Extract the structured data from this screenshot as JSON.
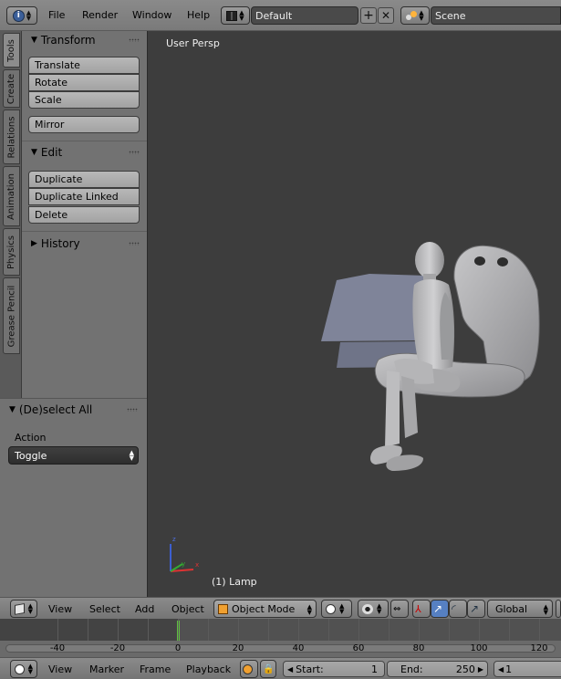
{
  "topbar": {
    "menus": [
      "File",
      "Render",
      "Window",
      "Help"
    ],
    "screen_layout": "Default",
    "scene": "Scene"
  },
  "tabs": [
    "Tools",
    "Create",
    "Relations",
    "Animation",
    "Physics",
    "Grease Pencil"
  ],
  "toolshelf": {
    "transform": {
      "title": "Transform",
      "buttons": [
        "Translate",
        "Rotate",
        "Scale"
      ],
      "mirror": "Mirror"
    },
    "edit": {
      "title": "Edit",
      "buttons": [
        "Duplicate",
        "Duplicate Linked",
        "Delete"
      ]
    },
    "history": {
      "title": "History"
    }
  },
  "operator": {
    "title": "(De)select All",
    "action_label": "Action",
    "action_value": "Toggle"
  },
  "viewport": {
    "view_label": "User Persp",
    "object_label": "(1) Lamp",
    "axis_labels": [
      "z",
      "y",
      "x"
    ]
  },
  "header3d": {
    "menus": [
      "View",
      "Select",
      "Add",
      "Object"
    ],
    "mode": "Object Mode",
    "orientation": "Global"
  },
  "timeline": {
    "ticks": [
      "-40",
      "-20",
      "0",
      "20",
      "40",
      "60",
      "80",
      "100",
      "120"
    ],
    "current_frame": 0
  },
  "timeline_header": {
    "menus": [
      "View",
      "Marker",
      "Frame",
      "Playback"
    ],
    "start_label": "Start:",
    "start_value": "1",
    "end_label": "End:",
    "end_value": "250",
    "current_value": "1"
  },
  "colors": {
    "accent_blue": "#5680c2",
    "frame_cursor": "#60c040"
  }
}
